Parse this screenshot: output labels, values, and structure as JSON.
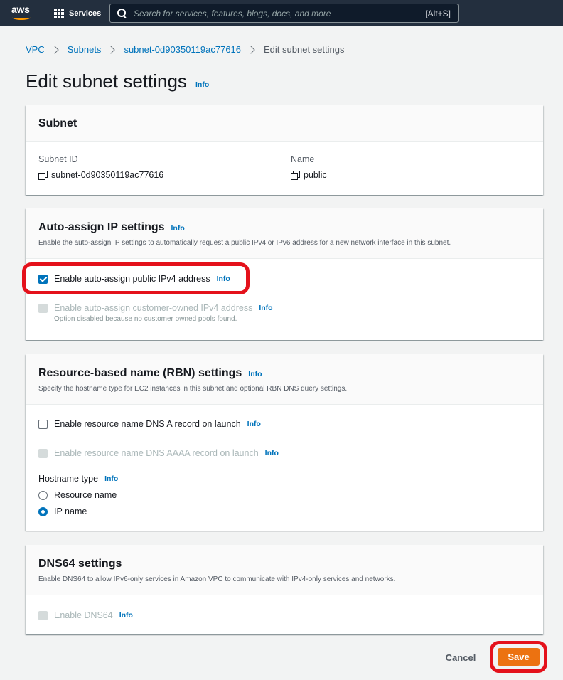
{
  "topnav": {
    "logo_text": "aws",
    "services_label": "Services",
    "search_placeholder": "Search for services, features, blogs, docs, and more",
    "search_shortcut": "[Alt+S]"
  },
  "breadcrumb": {
    "items": [
      "VPC",
      "Subnets",
      "subnet-0d90350119ac77616"
    ],
    "current": "Edit subnet settings"
  },
  "page": {
    "title": "Edit subnet settings",
    "info": "Info"
  },
  "subnet_panel": {
    "title": "Subnet",
    "subnet_id_label": "Subnet ID",
    "subnet_id_value": "subnet-0d90350119ac77616",
    "name_label": "Name",
    "name_value": "public"
  },
  "auto_assign_panel": {
    "title": "Auto-assign IP settings",
    "info": "Info",
    "description": "Enable the auto-assign IP settings to automatically request a public IPv4 or IPv6 address for a new network interface in this subnet.",
    "ipv4": {
      "label": "Enable auto-assign public IPv4 address",
      "info": "Info",
      "checked": true
    },
    "customer_owned": {
      "label": "Enable auto-assign customer-owned IPv4 address",
      "info": "Info",
      "checked": false,
      "disabled": true,
      "note": "Option disabled because no customer owned pools found."
    }
  },
  "rbn_panel": {
    "title": "Resource-based name (RBN) settings",
    "info": "Info",
    "description": "Specify the hostname type for EC2 instances in this subnet and optional RBN DNS query settings.",
    "dns_a": {
      "label": "Enable resource name DNS A record on launch",
      "info": "Info",
      "checked": false
    },
    "dns_aaaa": {
      "label": "Enable resource name DNS AAAA record on launch",
      "info": "Info",
      "checked": false,
      "disabled": true
    },
    "hostname_type_label": "Hostname type",
    "hostname_type_info": "Info",
    "options": [
      {
        "label": "Resource name",
        "selected": false
      },
      {
        "label": "IP name",
        "selected": true
      }
    ]
  },
  "dns64_panel": {
    "title": "DNS64 settings",
    "description": "Enable DNS64 to allow IPv6-only services in Amazon VPC to communicate with IPv4-only services and networks.",
    "enable": {
      "label": "Enable DNS64",
      "info": "Info",
      "checked": false,
      "disabled": true
    }
  },
  "footer": {
    "cancel_label": "Cancel",
    "save_label": "Save"
  },
  "colors": {
    "nav_bg": "#232f3e",
    "link": "#0073bb",
    "primary_button": "#ec7211",
    "highlight": "#e4111b"
  }
}
